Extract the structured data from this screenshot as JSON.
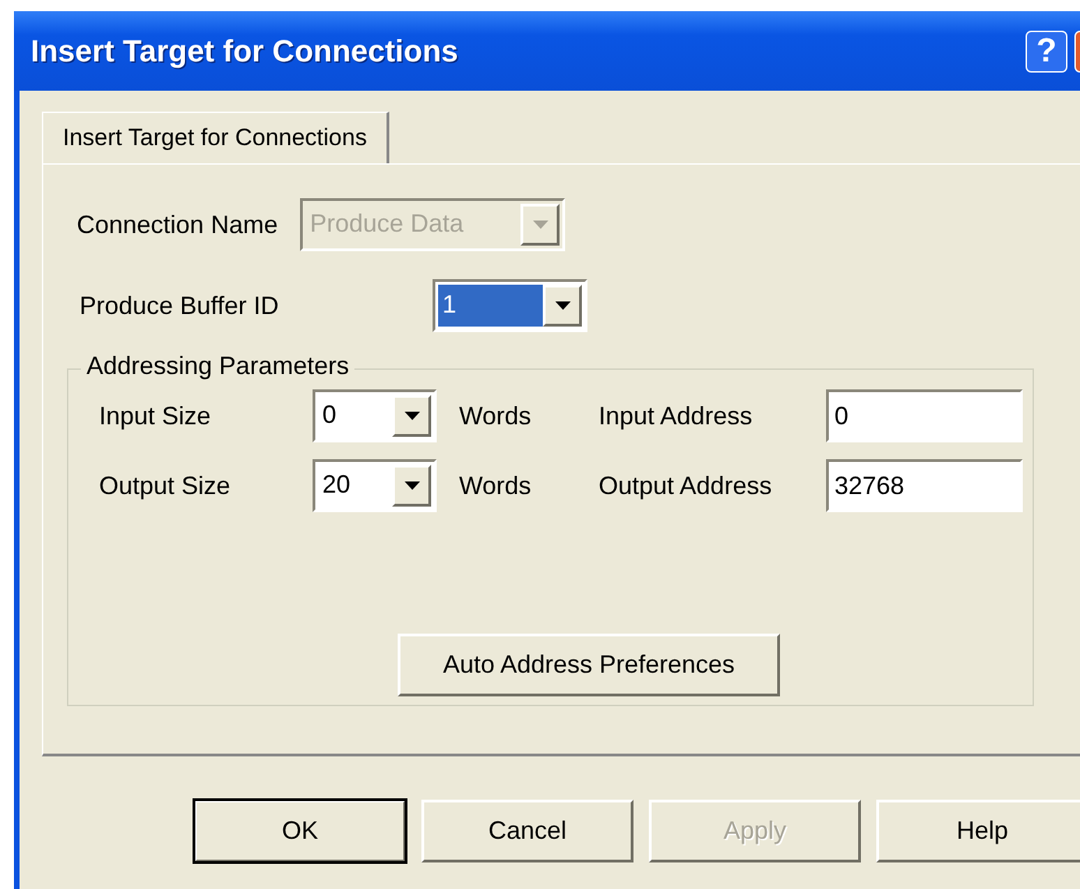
{
  "window": {
    "title": "Insert Target for Connections",
    "help_glyph": "?"
  },
  "tabs": [
    {
      "label": "Insert Target for Connections",
      "selected": true
    }
  ],
  "connection_name": {
    "label": "Connection Name",
    "value": "Produce Data",
    "disabled": true
  },
  "produce_buffer_id": {
    "label": "Produce Buffer ID",
    "value": "1",
    "value_selected": true,
    "disabled": false
  },
  "addressing": {
    "title": "Addressing Parameters",
    "rows": [
      {
        "size_label": "Input Size",
        "size_value": "0",
        "unit": "Words",
        "address_label": "Input Address",
        "address_value": "0"
      },
      {
        "size_label": "Output Size",
        "size_value": "20",
        "unit": "Words",
        "address_label": "Output Address",
        "address_value": "32768"
      }
    ],
    "button": "Auto Address Preferences"
  },
  "buttons": [
    {
      "label": "OK",
      "default": true,
      "disabled": false
    },
    {
      "label": "Cancel",
      "default": false,
      "disabled": false
    },
    {
      "label": "Apply",
      "default": false,
      "disabled": true
    },
    {
      "label": "Help",
      "default": false,
      "disabled": false
    }
  ]
}
